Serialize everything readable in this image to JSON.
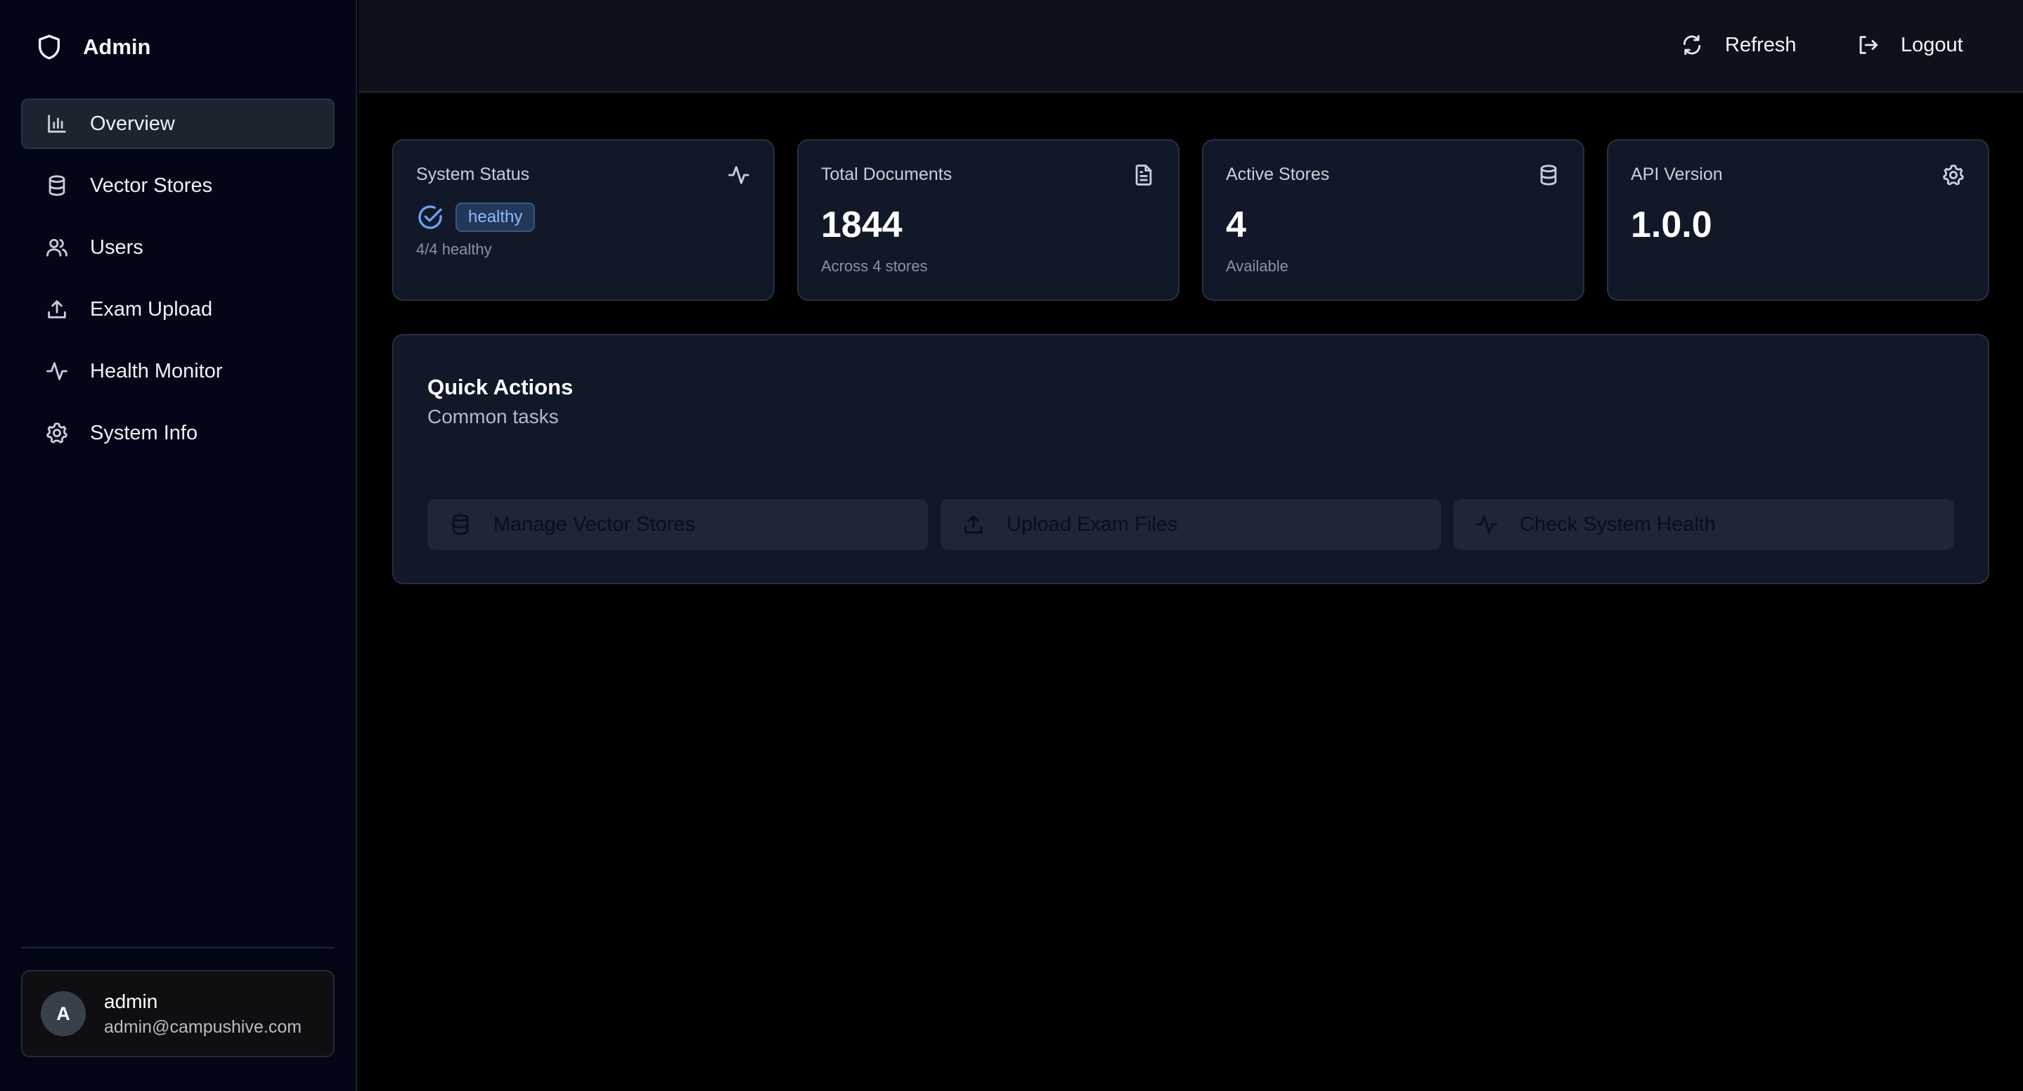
{
  "sidebar": {
    "brand": {
      "icon": "shield-icon",
      "label": "Admin"
    },
    "items": [
      {
        "label": "Overview",
        "icon": "bar-chart-icon",
        "active": true
      },
      {
        "label": "Vector Stores",
        "icon": "database-icon",
        "active": false
      },
      {
        "label": "Users",
        "icon": "users-icon",
        "active": false
      },
      {
        "label": "Exam Upload",
        "icon": "upload-icon",
        "active": false
      },
      {
        "label": "Health Monitor",
        "icon": "activity-icon",
        "active": false
      },
      {
        "label": "System Info",
        "icon": "gear-icon",
        "active": false
      }
    ],
    "user": {
      "initial": "A",
      "name": "admin",
      "email": "admin@campushive.com"
    }
  },
  "topbar": {
    "refresh_label": "Refresh",
    "logout_label": "Logout"
  },
  "stats": [
    {
      "title": "System Status",
      "icon": "activity-icon",
      "badge": "healthy",
      "sub": "4/4 healthy"
    },
    {
      "title": "Total Documents",
      "icon": "document-icon",
      "value": "1844",
      "sub": "Across 4 stores"
    },
    {
      "title": "Active Stores",
      "icon": "database-icon",
      "value": "4",
      "sub": "Available"
    },
    {
      "title": "API Version",
      "icon": "gear-icon",
      "value": "1.0.0"
    }
  ],
  "quick_actions": {
    "title": "Quick Actions",
    "subtitle": "Common tasks",
    "actions": [
      {
        "label": "Manage Vector Stores",
        "icon": "database-icon"
      },
      {
        "label": "Upload Exam Files",
        "icon": "upload-icon"
      },
      {
        "label": "Check System Health",
        "icon": "activity-icon"
      }
    ]
  },
  "colors": {
    "background": "#000000",
    "sidebar": "#020617",
    "card": "#111827",
    "accent_blue": "#6aa3f7",
    "badge_bg": "#23375a"
  }
}
